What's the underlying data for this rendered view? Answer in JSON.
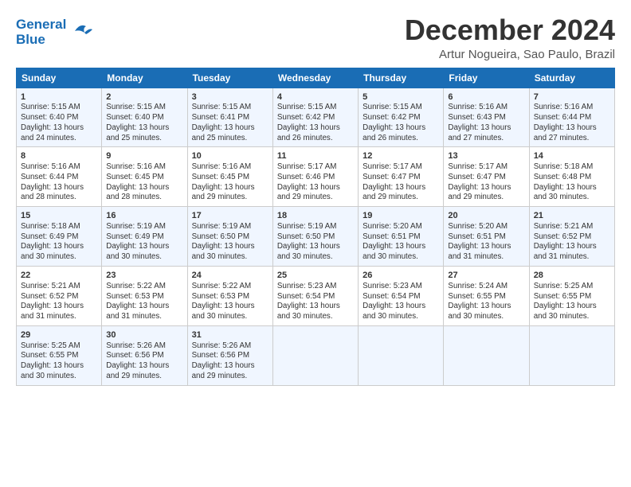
{
  "logo": {
    "line1": "General",
    "line2": "Blue"
  },
  "title": "December 2024",
  "subtitle": "Artur Nogueira, Sao Paulo, Brazil",
  "columns": [
    "Sunday",
    "Monday",
    "Tuesday",
    "Wednesday",
    "Thursday",
    "Friday",
    "Saturday"
  ],
  "weeks": [
    [
      {
        "day": "1",
        "lines": [
          "Sunrise: 5:15 AM",
          "Sunset: 6:40 PM",
          "Daylight: 13 hours",
          "and 24 minutes."
        ]
      },
      {
        "day": "2",
        "lines": [
          "Sunrise: 5:15 AM",
          "Sunset: 6:40 PM",
          "Daylight: 13 hours",
          "and 25 minutes."
        ]
      },
      {
        "day": "3",
        "lines": [
          "Sunrise: 5:15 AM",
          "Sunset: 6:41 PM",
          "Daylight: 13 hours",
          "and 25 minutes."
        ]
      },
      {
        "day": "4",
        "lines": [
          "Sunrise: 5:15 AM",
          "Sunset: 6:42 PM",
          "Daylight: 13 hours",
          "and 26 minutes."
        ]
      },
      {
        "day": "5",
        "lines": [
          "Sunrise: 5:15 AM",
          "Sunset: 6:42 PM",
          "Daylight: 13 hours",
          "and 26 minutes."
        ]
      },
      {
        "day": "6",
        "lines": [
          "Sunrise: 5:16 AM",
          "Sunset: 6:43 PM",
          "Daylight: 13 hours",
          "and 27 minutes."
        ]
      },
      {
        "day": "7",
        "lines": [
          "Sunrise: 5:16 AM",
          "Sunset: 6:44 PM",
          "Daylight: 13 hours",
          "and 27 minutes."
        ]
      }
    ],
    [
      {
        "day": "8",
        "lines": [
          "Sunrise: 5:16 AM",
          "Sunset: 6:44 PM",
          "Daylight: 13 hours",
          "and 28 minutes."
        ]
      },
      {
        "day": "9",
        "lines": [
          "Sunrise: 5:16 AM",
          "Sunset: 6:45 PM",
          "Daylight: 13 hours",
          "and 28 minutes."
        ]
      },
      {
        "day": "10",
        "lines": [
          "Sunrise: 5:16 AM",
          "Sunset: 6:45 PM",
          "Daylight: 13 hours",
          "and 29 minutes."
        ]
      },
      {
        "day": "11",
        "lines": [
          "Sunrise: 5:17 AM",
          "Sunset: 6:46 PM",
          "Daylight: 13 hours",
          "and 29 minutes."
        ]
      },
      {
        "day": "12",
        "lines": [
          "Sunrise: 5:17 AM",
          "Sunset: 6:47 PM",
          "Daylight: 13 hours",
          "and 29 minutes."
        ]
      },
      {
        "day": "13",
        "lines": [
          "Sunrise: 5:17 AM",
          "Sunset: 6:47 PM",
          "Daylight: 13 hours",
          "and 29 minutes."
        ]
      },
      {
        "day": "14",
        "lines": [
          "Sunrise: 5:18 AM",
          "Sunset: 6:48 PM",
          "Daylight: 13 hours",
          "and 30 minutes."
        ]
      }
    ],
    [
      {
        "day": "15",
        "lines": [
          "Sunrise: 5:18 AM",
          "Sunset: 6:49 PM",
          "Daylight: 13 hours",
          "and 30 minutes."
        ]
      },
      {
        "day": "16",
        "lines": [
          "Sunrise: 5:19 AM",
          "Sunset: 6:49 PM",
          "Daylight: 13 hours",
          "and 30 minutes."
        ]
      },
      {
        "day": "17",
        "lines": [
          "Sunrise: 5:19 AM",
          "Sunset: 6:50 PM",
          "Daylight: 13 hours",
          "and 30 minutes."
        ]
      },
      {
        "day": "18",
        "lines": [
          "Sunrise: 5:19 AM",
          "Sunset: 6:50 PM",
          "Daylight: 13 hours",
          "and 30 minutes."
        ]
      },
      {
        "day": "19",
        "lines": [
          "Sunrise: 5:20 AM",
          "Sunset: 6:51 PM",
          "Daylight: 13 hours",
          "and 30 minutes."
        ]
      },
      {
        "day": "20",
        "lines": [
          "Sunrise: 5:20 AM",
          "Sunset: 6:51 PM",
          "Daylight: 13 hours",
          "and 31 minutes."
        ]
      },
      {
        "day": "21",
        "lines": [
          "Sunrise: 5:21 AM",
          "Sunset: 6:52 PM",
          "Daylight: 13 hours",
          "and 31 minutes."
        ]
      }
    ],
    [
      {
        "day": "22",
        "lines": [
          "Sunrise: 5:21 AM",
          "Sunset: 6:52 PM",
          "Daylight: 13 hours",
          "and 31 minutes."
        ]
      },
      {
        "day": "23",
        "lines": [
          "Sunrise: 5:22 AM",
          "Sunset: 6:53 PM",
          "Daylight: 13 hours",
          "and 31 minutes."
        ]
      },
      {
        "day": "24",
        "lines": [
          "Sunrise: 5:22 AM",
          "Sunset: 6:53 PM",
          "Daylight: 13 hours",
          "and 30 minutes."
        ]
      },
      {
        "day": "25",
        "lines": [
          "Sunrise: 5:23 AM",
          "Sunset: 6:54 PM",
          "Daylight: 13 hours",
          "and 30 minutes."
        ]
      },
      {
        "day": "26",
        "lines": [
          "Sunrise: 5:23 AM",
          "Sunset: 6:54 PM",
          "Daylight: 13 hours",
          "and 30 minutes."
        ]
      },
      {
        "day": "27",
        "lines": [
          "Sunrise: 5:24 AM",
          "Sunset: 6:55 PM",
          "Daylight: 13 hours",
          "and 30 minutes."
        ]
      },
      {
        "day": "28",
        "lines": [
          "Sunrise: 5:25 AM",
          "Sunset: 6:55 PM",
          "Daylight: 13 hours",
          "and 30 minutes."
        ]
      }
    ],
    [
      {
        "day": "29",
        "lines": [
          "Sunrise: 5:25 AM",
          "Sunset: 6:55 PM",
          "Daylight: 13 hours",
          "and 30 minutes."
        ]
      },
      {
        "day": "30",
        "lines": [
          "Sunrise: 5:26 AM",
          "Sunset: 6:56 PM",
          "Daylight: 13 hours",
          "and 29 minutes."
        ]
      },
      {
        "day": "31",
        "lines": [
          "Sunrise: 5:26 AM",
          "Sunset: 6:56 PM",
          "Daylight: 13 hours",
          "and 29 minutes."
        ]
      },
      {
        "day": "",
        "lines": []
      },
      {
        "day": "",
        "lines": []
      },
      {
        "day": "",
        "lines": []
      },
      {
        "day": "",
        "lines": []
      }
    ]
  ]
}
